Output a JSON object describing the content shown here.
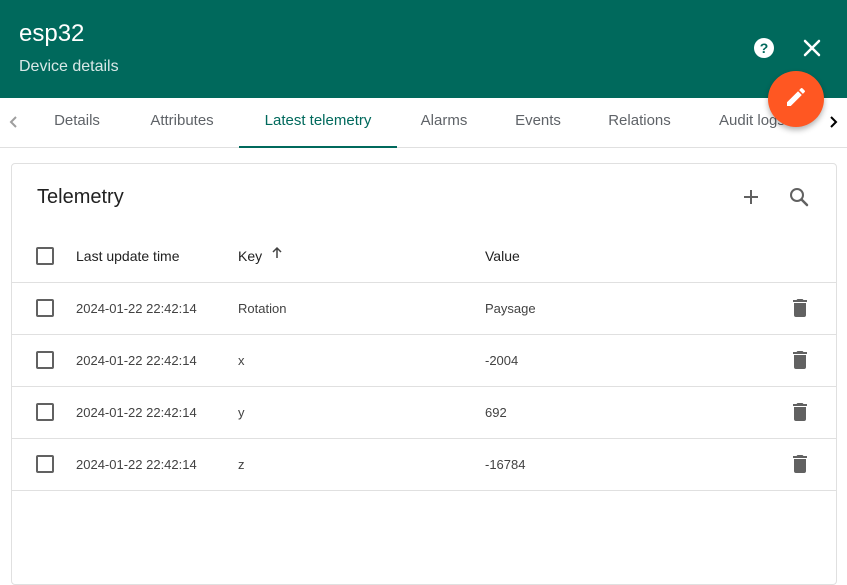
{
  "header": {
    "title": "esp32",
    "subtitle": "Device details",
    "help_icon": "help-circle-icon",
    "close_icon": "close-icon",
    "edit_icon": "pencil-icon",
    "color": "#00695c",
    "fab_color": "#ff5722"
  },
  "tabs": [
    {
      "label": "Details"
    },
    {
      "label": "Attributes"
    },
    {
      "label": "Latest telemetry",
      "active": true
    },
    {
      "label": "Alarms"
    },
    {
      "label": "Events"
    },
    {
      "label": "Relations"
    },
    {
      "label": "Audit logs"
    }
  ],
  "telemetry": {
    "title": "Telemetry",
    "add_icon": "plus-icon",
    "search_icon": "search-icon",
    "columns": {
      "time": "Last update time",
      "key": "Key",
      "value": "Value",
      "key_sort_icon": "arrow-up-icon"
    },
    "rows": [
      {
        "time": "2024-01-22 22:42:14",
        "key": "Rotation",
        "value": "Paysage"
      },
      {
        "time": "2024-01-22 22:42:14",
        "key": "x",
        "value": "-2004"
      },
      {
        "time": "2024-01-22 22:42:14",
        "key": "y",
        "value": "692"
      },
      {
        "time": "2024-01-22 22:42:14",
        "key": "z",
        "value": "-16784"
      }
    ],
    "delete_icon": "delete-icon"
  }
}
